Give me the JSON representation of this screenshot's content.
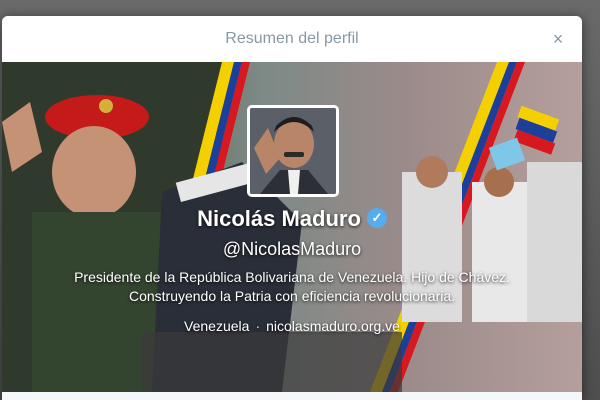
{
  "modal": {
    "title": "Resumen del perfil",
    "close_symbol": "×"
  },
  "profile": {
    "name": "Nicolás Maduro",
    "verified_symbol": "✓",
    "handle": "@NicolasMaduro",
    "bio_line1": "Presidente de la República Bolivariana de Venezuela. Hijo de Chávez.",
    "bio_line2": "Construyendo la Patria con eficiencia revolucionaria.",
    "location": "Venezuela",
    "separator": "·",
    "website": "nicolasmaduro.org.ve"
  },
  "icons": {
    "close": "close-icon",
    "verified": "verified-badge-icon"
  },
  "colors": {
    "header_text": "#8899a6",
    "verified_blue": "#55acee",
    "banner_accent_yellow": "#f4d000",
    "banner_accent_red": "#d7191f",
    "banner_accent_blue": "#1c3f9a"
  }
}
